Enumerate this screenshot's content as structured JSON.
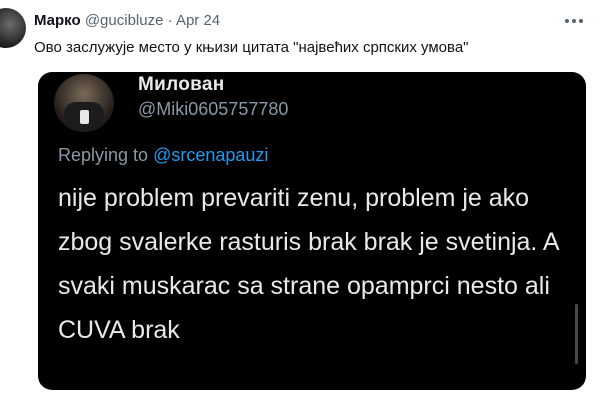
{
  "tweet": {
    "author_name": "Марко",
    "author_handle": "@gucibluze",
    "separator": "·",
    "date": "Apr 24",
    "more_icon": "more-horizontal-icon",
    "text": "Ово заслужује место у књизи цитата \"највећих српских умова\""
  },
  "quoted": {
    "author_name": "Милован",
    "author_handle": "@Miki0605757780",
    "replying_prefix": "Replying to",
    "replying_to": "@srcenapauzi",
    "body": "nije problem prevariti zenu, problem je ako zbog svalerke rasturis brak brak je svetinja. A svaki muskarac sa strane opamprci nesto ali CUVA brak"
  },
  "colors": {
    "text_primary": "#0f1419",
    "text_secondary": "#536471",
    "embed_background": "#000000",
    "link": "#1d9bf0"
  }
}
